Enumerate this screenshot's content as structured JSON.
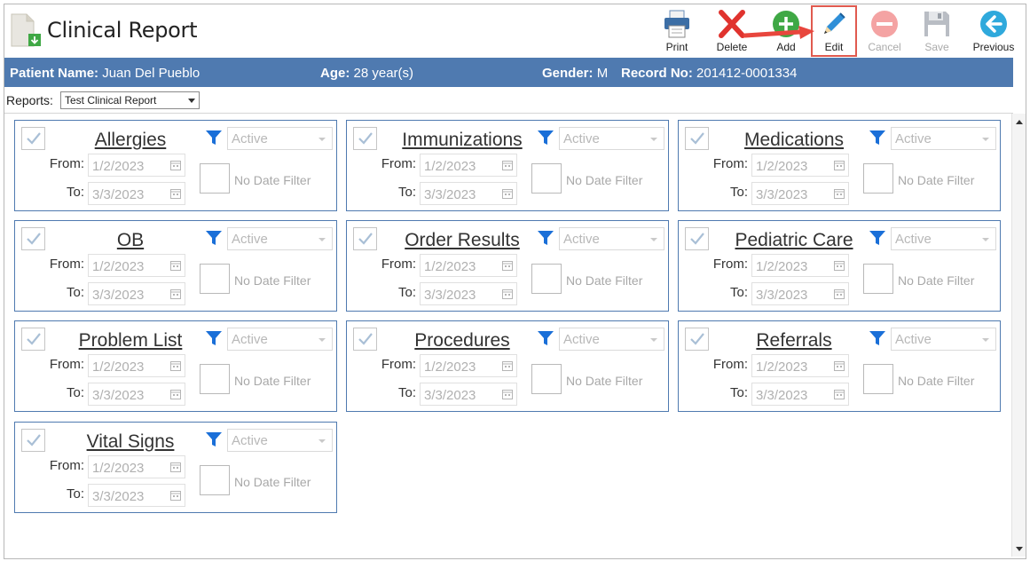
{
  "app": {
    "title": "Clinical Report"
  },
  "toolbar": {
    "print": "Print",
    "delete": "Delete",
    "add": "Add",
    "edit": "Edit",
    "cancel": "Cancel",
    "save": "Save",
    "previous": "Previous"
  },
  "patient": {
    "name_label": "Patient Name:",
    "name": "Juan Del Pueblo",
    "age_label": "Age:",
    "age": "28 year(s)",
    "gender_label": "Gender:",
    "gender": "M",
    "record_label": "Record No:",
    "record": "201412-0001334"
  },
  "reports": {
    "label": "Reports:",
    "selected": "Test Clinical Report"
  },
  "card_labels": {
    "from": "From:",
    "to": "To:",
    "no_date_filter": "No Date Filter"
  },
  "cards": [
    {
      "title": "Allergies",
      "status": "Active",
      "from": "1/2/2023",
      "to": "3/3/2023"
    },
    {
      "title": "Immunizations",
      "status": "Active",
      "from": "1/2/2023",
      "to": "3/3/2023"
    },
    {
      "title": "Medications",
      "status": "Active",
      "from": "1/2/2023",
      "to": "3/3/2023"
    },
    {
      "title": "OB",
      "status": "Active",
      "from": "1/2/2023",
      "to": "3/3/2023"
    },
    {
      "title": "Order Results",
      "status": "Active",
      "from": "1/2/2023",
      "to": "3/3/2023"
    },
    {
      "title": "Pediatric Care",
      "status": "Active",
      "from": "1/2/2023",
      "to": "3/3/2023"
    },
    {
      "title": "Problem List",
      "status": "Active",
      "from": "1/2/2023",
      "to": "3/3/2023"
    },
    {
      "title": "Procedures",
      "status": "Active",
      "from": "1/2/2023",
      "to": "3/3/2023"
    },
    {
      "title": "Referrals",
      "status": "Active",
      "from": "1/2/2023",
      "to": "3/3/2023"
    },
    {
      "title": "Vital Signs",
      "status": "Active",
      "from": "1/2/2023",
      "to": "3/3/2023"
    }
  ],
  "colors": {
    "accent_bar": "#4f7ab0",
    "card_border": "#4f7ab0",
    "filter_icon": "#1a6fd8",
    "highlight": "#e05a4f"
  }
}
